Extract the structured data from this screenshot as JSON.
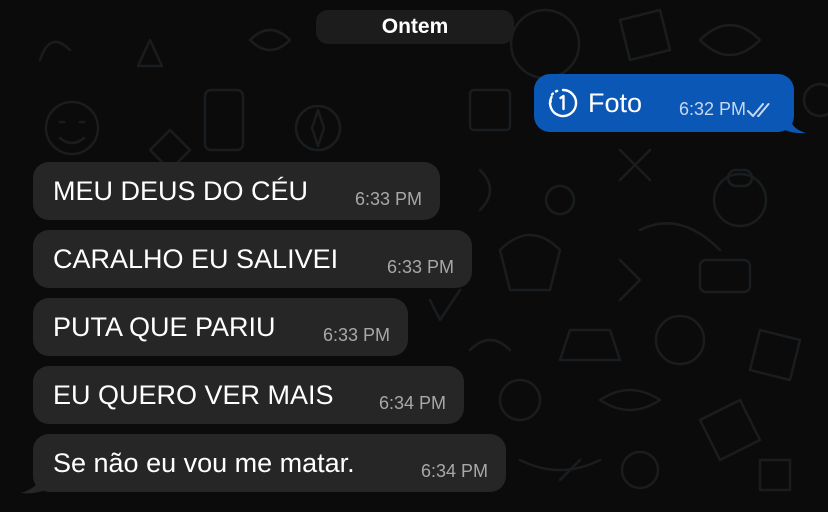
{
  "chat": {
    "date_separator": "Ontem",
    "outgoing": {
      "label": "Foto",
      "time": "6:32 PM",
      "status_icon": "double-check-icon",
      "media_icon": "view-once-icon"
    },
    "incoming": [
      {
        "text": "MEU DEUS DO CÉU",
        "time": "6:33 PM"
      },
      {
        "text": "CARALHO EU SALIVEI",
        "time": "6:33 PM"
      },
      {
        "text": "PUTA QUE PARIU",
        "time": "6:33 PM"
      },
      {
        "text": "EU QUERO VER MAIS",
        "time": "6:34 PM"
      },
      {
        "text": "Se não eu vou me matar.",
        "time": "6:34 PM"
      }
    ]
  },
  "colors": {
    "background": "#0b0b0b",
    "incoming_bubble": "#262626",
    "outgoing_bubble": "#0b57b5",
    "date_pill": "#1c1c1c"
  }
}
